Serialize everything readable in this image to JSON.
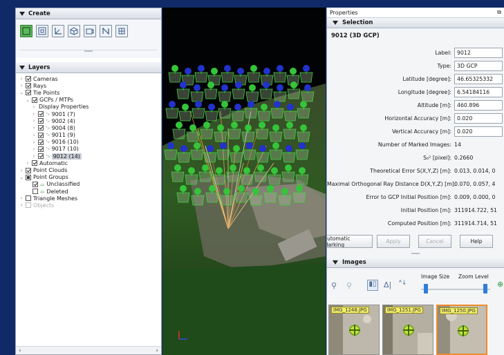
{
  "create": {
    "title": "Create"
  },
  "layers": {
    "title": "Layers",
    "items": [
      {
        "label": "Cameras"
      },
      {
        "label": "Rays"
      },
      {
        "label": "Tie Points"
      },
      {
        "label": "GCPs / MTPs"
      },
      {
        "label": "Display Properties"
      },
      {
        "label": "9001 (7)"
      },
      {
        "label": "9002 (4)"
      },
      {
        "label": "9004 (8)"
      },
      {
        "label": "9011 (9)"
      },
      {
        "label": "9016 (10)"
      },
      {
        "label": "9017 (10)"
      },
      {
        "label": "9012 (14)"
      },
      {
        "label": "Automatic"
      },
      {
        "label": "Point Clouds"
      },
      {
        "label": "Point Groups"
      },
      {
        "label": "Unclassified"
      },
      {
        "label": "Deleted"
      },
      {
        "label": "Triangle Meshes"
      },
      {
        "label": "Objects"
      }
    ]
  },
  "properties": {
    "title": "Properties",
    "selection_title": "Selection",
    "gcp_name": "9012 (3D GCP)",
    "rows": [
      {
        "label": "Label:",
        "value": "9012"
      },
      {
        "label": "Type:",
        "value": "3D GCP"
      },
      {
        "label": "Latitude [degree]:",
        "value": "46.65325332"
      },
      {
        "label": "Longitude [degree]:",
        "value": "6.54184116"
      },
      {
        "label": "Altitude [m]:",
        "value": "460.896"
      },
      {
        "label": "Horizontal Accuracy [m]:",
        "value": "0.020"
      },
      {
        "label": "Vertical Accuracy [m]:",
        "value": "0.020"
      },
      {
        "label": "Number of Marked Images:",
        "value": "14"
      },
      {
        "label": "S₀² [pixel]:",
        "value": "0.2660"
      },
      {
        "label": "Theoretical Error S(X,Y,Z) [m]:",
        "value": "0.013, 0.014, 0"
      },
      {
        "label": "Maximal Orthogonal Ray Distance D(X,Y,Z) [m]:",
        "value": "0.070, 0.057, 4"
      },
      {
        "label": "Error to GCP Initial Position [m]:",
        "value": "0.009, 0.000, 0"
      },
      {
        "label": "Initial Position [m]:",
        "value": "311914.722, 51"
      },
      {
        "label": "Computed Position [m]:",
        "value": "311914.714, 51"
      }
    ],
    "buttons": {
      "automatic_marking": "Automatic Marking",
      "apply": "Apply",
      "cancel": "Cancel",
      "help": "Help"
    }
  },
  "images": {
    "title": "Images",
    "image_size_label": "Image Size",
    "zoom_level_label": "Zoom Level",
    "thumbnails": [
      {
        "label": "IMG_1248.JPG"
      },
      {
        "label": "IMG_1251.JPG"
      },
      {
        "label": "IMG_1250.JPG"
      }
    ]
  }
}
